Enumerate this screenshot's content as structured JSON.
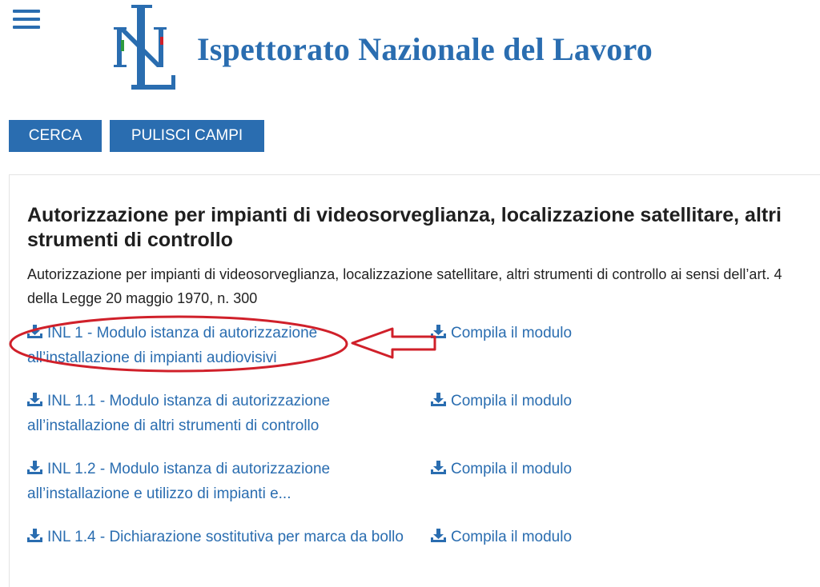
{
  "header": {
    "site_title": "Ispettorato Nazionale del Lavoro",
    "menu_icon": "hamburger-menu-icon",
    "logo_icon": "inl-logo-icon",
    "brand_color": "#2a6db0"
  },
  "toolbar": {
    "search_label": "CERCA",
    "clear_label": "PULISCI CAMPI"
  },
  "section": {
    "title": "Autorizzazione per impianti di videosorveglianza, localizzazione satellitare, altri strumenti di controllo",
    "description": "Autorizzazione per impianti di videosorveglianza, localizzazione satellitare, altri strumenti di controllo ai sensi dell’art. 4 della Legge 20 maggio 1970, n. 300"
  },
  "documents": [
    {
      "label": "INL 1 - Modulo istanza di autorizzazione all’installazione di impianti audiovisivi",
      "action": "Compila il modulo"
    },
    {
      "label": "INL 1.1 - Modulo istanza di autorizzazione all’installazione di altri strumenti di controllo",
      "action": "Compila il modulo"
    },
    {
      "label": "INL 1.2 - Modulo istanza di autorizzazione all’installazione e utilizzo di impianti e...",
      "action": "Compila il modulo"
    },
    {
      "label": "INL 1.4 - Dichiarazione sostitutiva per marca da bollo",
      "action": "Compila il modulo"
    }
  ],
  "annotation": {
    "color": "#d0202a",
    "shapes": [
      "ellipse",
      "arrow"
    ]
  }
}
